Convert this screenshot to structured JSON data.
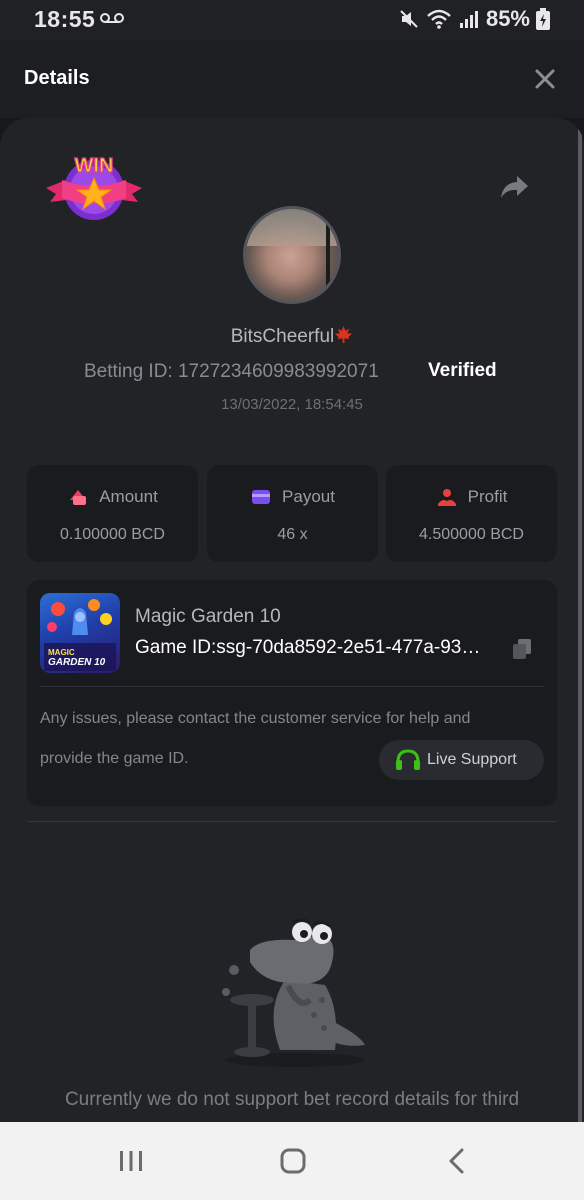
{
  "status_bar": {
    "time": "18:55",
    "battery": "85%",
    "icons": [
      "voicemail-icon",
      "mute-icon",
      "wifi-icon",
      "signal-icon",
      "battery-charging-icon"
    ]
  },
  "header": {
    "title": "Details",
    "close_icon": "close-icon"
  },
  "bet": {
    "badge_text": "WIN",
    "username": "BitsCheerful",
    "betting_id": "Betting ID: 1727234609983992071",
    "verified": "Verified",
    "date": "13/03/2022, 18:54:45"
  },
  "stats": [
    {
      "label": "Amount",
      "value": "0.100000 BCD",
      "icon": "amount-icon"
    },
    {
      "label": "Payout",
      "value": "46 x",
      "icon": "payout-icon"
    },
    {
      "label": "Profit",
      "value": "4.500000 BCD",
      "icon": "profit-icon"
    }
  ],
  "game": {
    "name": "Magic Garden 10",
    "game_id": "Game ID:ssg-70da8592-2e51-477a-93…",
    "thumb_text_1": "MAGIC",
    "thumb_text_2": "GARDEN 10",
    "help_line_1": "Any issues, please contact the customer service for help and",
    "help_line_2": "provide the game ID.",
    "support_label": "Live Support"
  },
  "notice": {
    "text": "Currently we do not support bet record details for third"
  },
  "colors": {
    "accent_green": "#3bc117",
    "amount_pink": "#e8405e",
    "payout_purple": "#7b4cf0",
    "profit_red": "#e8403c"
  }
}
